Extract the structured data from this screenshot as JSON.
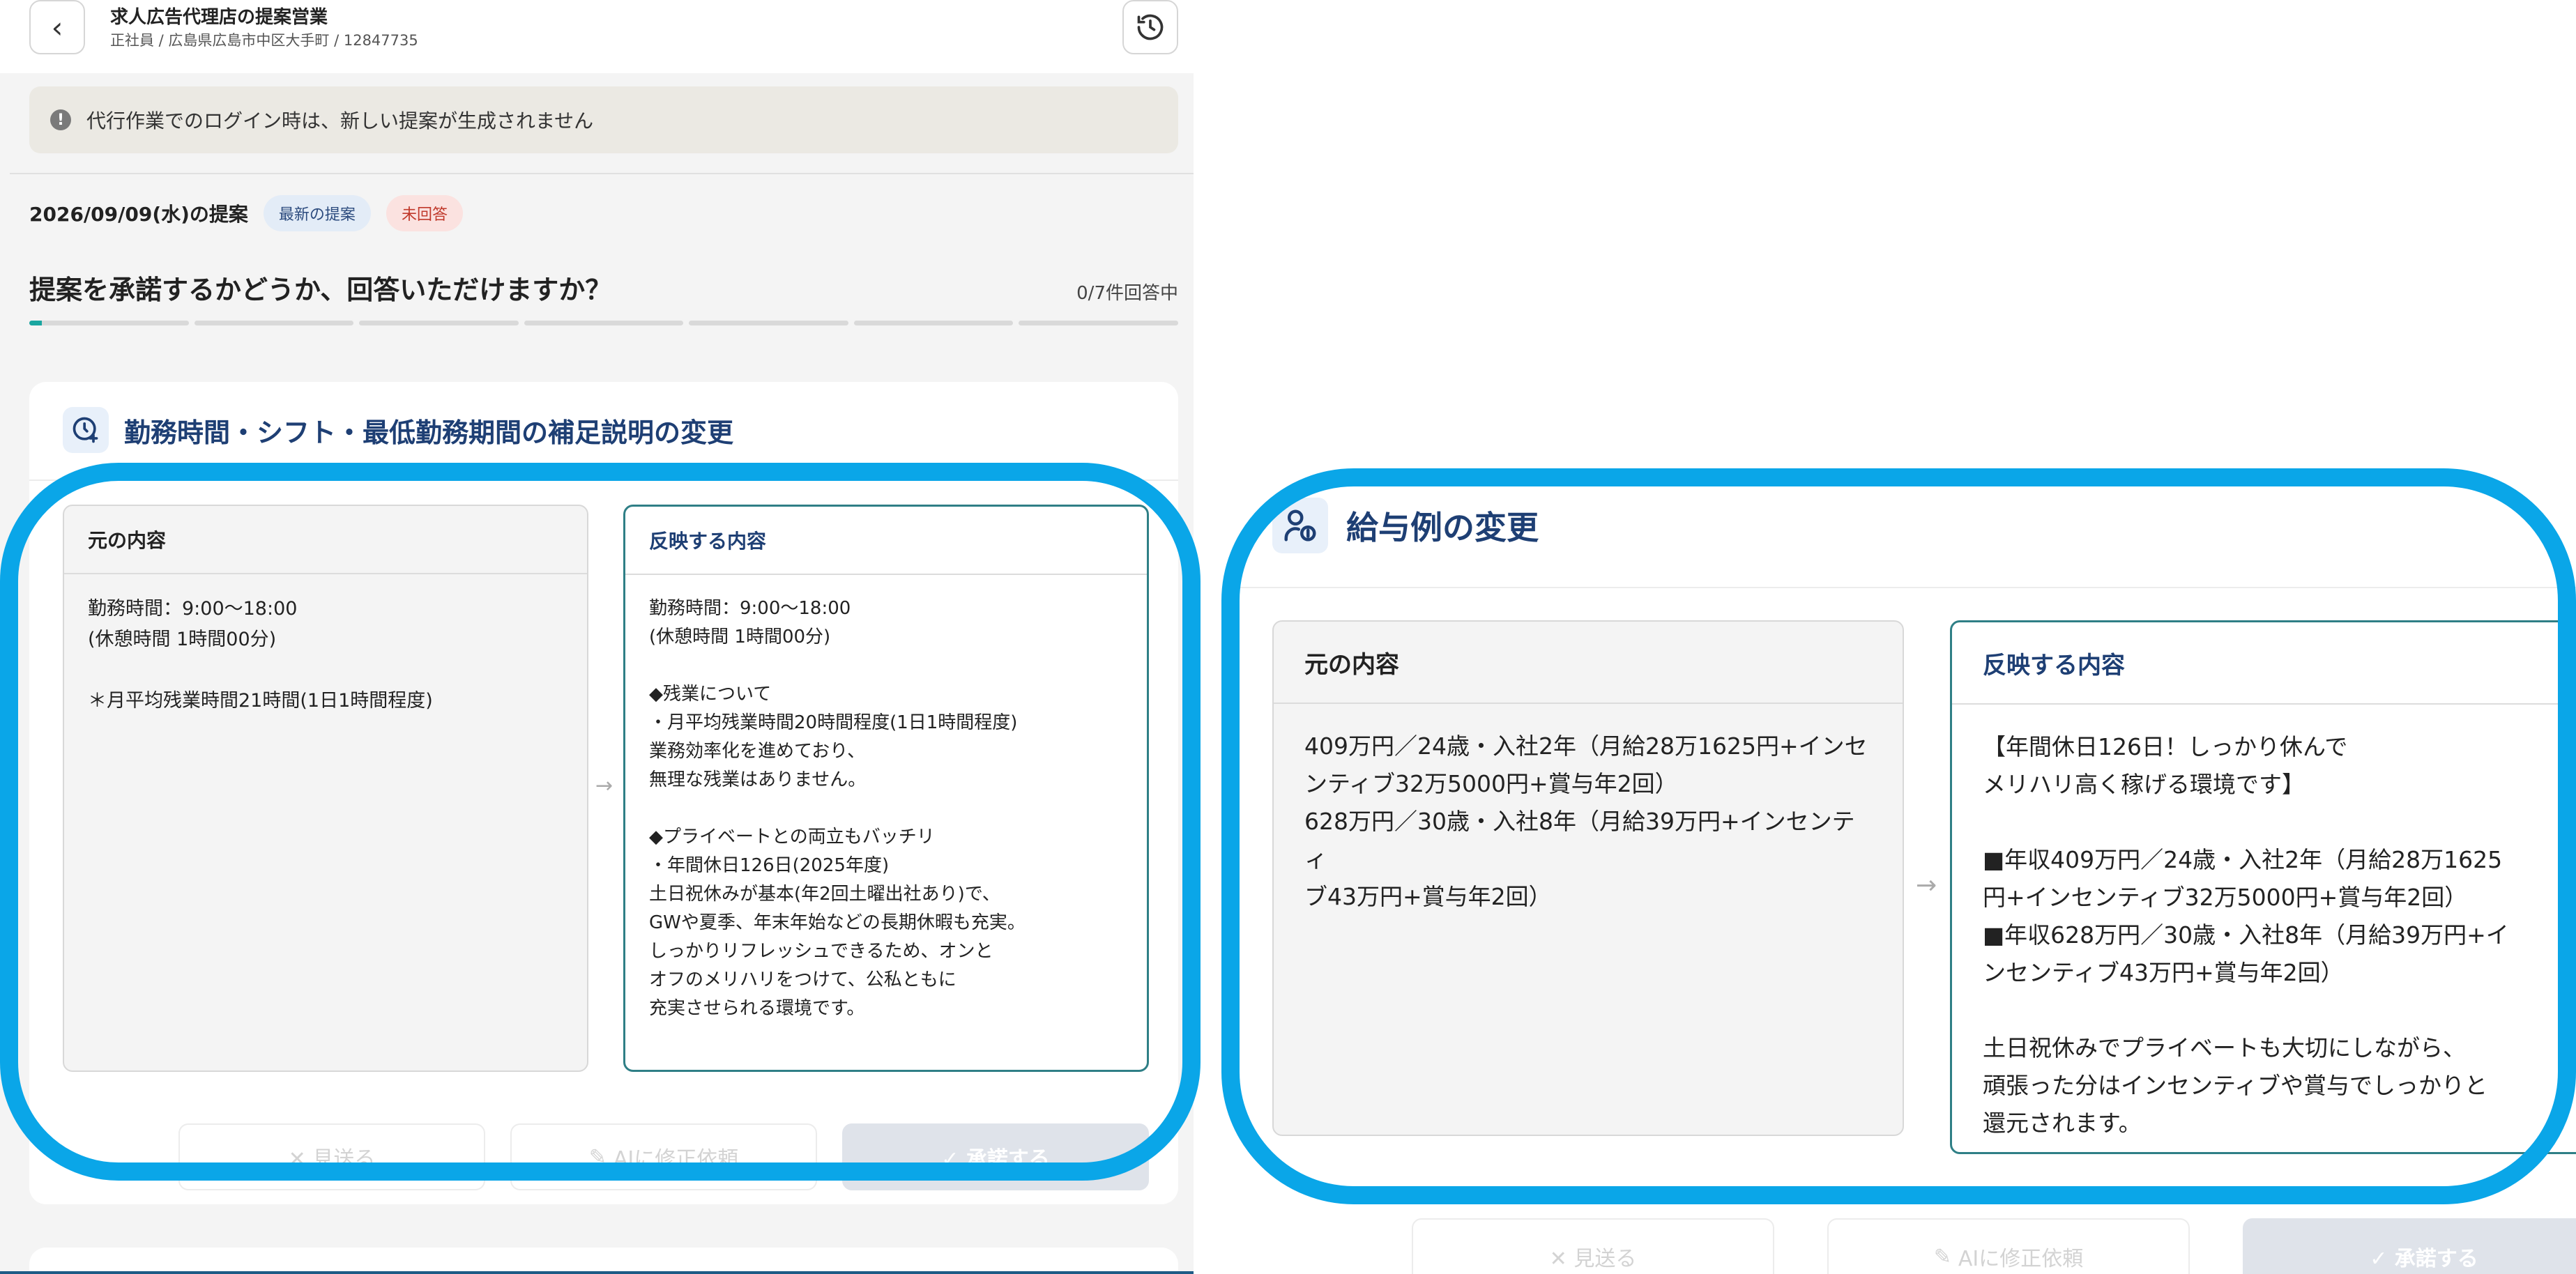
{
  "header": {
    "title": "求人広告代理店の提案営業",
    "subtitle": "正社員 / 広島県広島市中区大手町 / 12847735"
  },
  "notice": {
    "text": "代行作業でのログイン時は、新しい提案が生成されません"
  },
  "proposal": {
    "date": "2026/09/09(水)の提案",
    "badge_latest": "最新の提案",
    "badge_unanswered": "未回答"
  },
  "question": {
    "text": "提案を承諾するかどうか、回答いただけますか？",
    "count": "0/7件回答中",
    "progress_segments": 7,
    "answered": 0
  },
  "card1": {
    "title": "勤務時間・シフト・最低勤務期間の補足説明の変更",
    "original_label": "元の内容",
    "original_text": "勤務時間：9:00〜18:00\n(休憩時間 1時間00分)\n\n＊月平均残業時間21時間(1日1時間程度)",
    "reflected_label": "反映する内容",
    "reflected_text": "勤務時間：9:00〜18:00\n(休憩時間 1時間00分)\n\n◆残業について\n・月平均残業時間20時間程度(1日1時間程度)\n業務効率化を進めており、\n無理な残業はありません。\n\n◆プライベートとの両立もバッチリ\n・年間休日126日(2025年度)\n土日祝休みが基本(年2回土曜出社あり)で、\nGWや夏季、年末年始などの長期休暇も充実。\nしっかりリフレッシュできるため、オンと\nオフのメリハリをつけて、公私ともに\n充実させられる環境です。",
    "actions": {
      "skip": "✕ 見送る",
      "ai_fix": "AIに修正依頼",
      "accept": "✓ 承諾する"
    }
  },
  "card2": {
    "title": "給与例の変更",
    "original_label": "元の内容",
    "original_text": "409万円／24歳・入社2年（月給28万1625円+インセ\nンティブ32万5000円+賞与年2回）\n628万円／30歳・入社8年（月給39万円+インセンティ\nブ43万円+賞与年2回）",
    "reflected_label": "反映する内容",
    "reflected_text": "【年間休日126日！しっかり休んで\nメリハリ高く稼げる環境です】\n\n■年収409万円／24歳・入社2年（月給28万1625\n円+インセンティブ32万5000円+賞与年2回）\n■年収628万円／30歳・入社8年（月給39万円+イ\nンセンティブ43万円+賞与年2回）\n\n土日祝休みでプライベートも大切にしながら、\n頑張った分はインセンティブや賞与でしっかりと\n還元されます。",
    "actions": {
      "skip": "✕ 見送る",
      "ai_fix": "AIに修正依頼",
      "accept": "✓ 承諾する"
    }
  },
  "colors": {
    "accent_title": "#1e3f74",
    "highlight_ring": "#0aa6e8",
    "reflected_border": "#2f7f86",
    "progress_fill": "#1aa6a0"
  },
  "icons": [
    "chevron-left-icon",
    "history-icon",
    "info-icon",
    "clock-plus-icon",
    "money-person-icon",
    "arrow-right-icon"
  ]
}
